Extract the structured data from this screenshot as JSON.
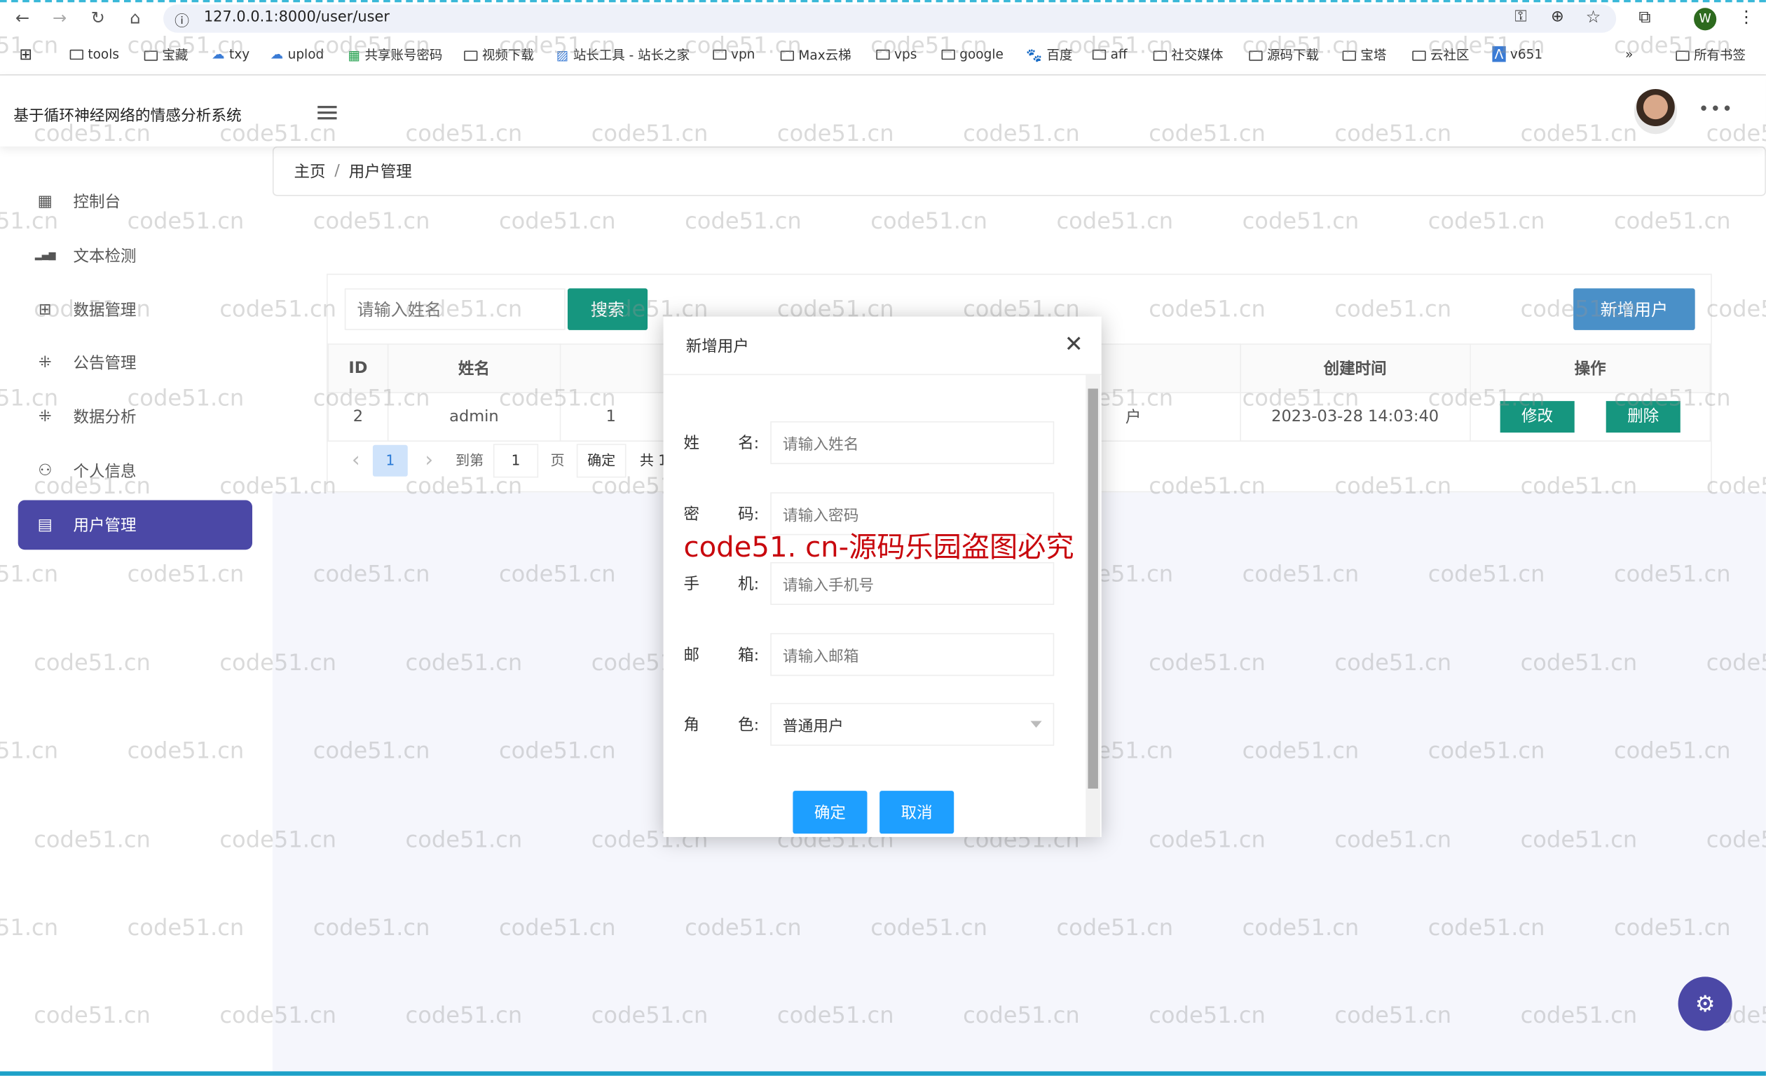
{
  "browser": {
    "url": "127.0.0.1:8000/user/user",
    "bookmarks": [
      {
        "label": "tools",
        "icon": "folder"
      },
      {
        "label": "宝藏",
        "icon": "folder"
      },
      {
        "label": "txy",
        "icon": "cloud"
      },
      {
        "label": "uplod",
        "icon": "cloud"
      },
      {
        "label": "共享账号密码",
        "icon": "sheet"
      },
      {
        "label": "视频下载",
        "icon": "folder"
      },
      {
        "label": "站长工具 - 站长之家",
        "icon": "site"
      },
      {
        "label": "vpn",
        "icon": "folder"
      },
      {
        "label": "Max云梯",
        "icon": "folder"
      },
      {
        "label": "vps",
        "icon": "folder"
      },
      {
        "label": "google",
        "icon": "folder"
      },
      {
        "label": "百度",
        "icon": "baidu"
      },
      {
        "label": "aff",
        "icon": "folder"
      },
      {
        "label": "社交媒体",
        "icon": "folder"
      },
      {
        "label": "源码下载",
        "icon": "folder"
      },
      {
        "label": "宝塔",
        "icon": "folder"
      },
      {
        "label": "云社区",
        "icon": "folder"
      },
      {
        "label": "v651",
        "icon": "app"
      }
    ],
    "all_bookmarks": "所有书签",
    "profile_initial": "W",
    "more_bookmarks": "»"
  },
  "app": {
    "title": "基于循环神经网络的情感分析系统"
  },
  "sidebar": {
    "items": [
      {
        "label": "控制台",
        "icon": "grid-icon"
      },
      {
        "label": "文本检测",
        "icon": "bar-chart-icon"
      },
      {
        "label": "数据管理",
        "icon": "table-icon"
      },
      {
        "label": "公告管理",
        "icon": "shrink-icon"
      },
      {
        "label": "数据分析",
        "icon": "shrink-icon"
      },
      {
        "label": "个人信息",
        "icon": "user-icon"
      },
      {
        "label": "用户管理",
        "icon": "document-icon",
        "active": true
      }
    ]
  },
  "breadcrumb": {
    "home": "主页",
    "sep": "/",
    "current": "用户管理"
  },
  "toolbar": {
    "search_placeholder": "请输入姓名",
    "search": "搜索",
    "add": "新增用户"
  },
  "table": {
    "headers": [
      "ID",
      "姓名",
      "",
      "",
      "",
      "创建时间",
      "操作"
    ],
    "rows": [
      {
        "id": "2",
        "name": "admin",
        "c3": "1",
        "c4": "",
        "c5": "户",
        "created": "2023-03-28 14:03:40",
        "edit": "修改",
        "delete": "删除"
      }
    ]
  },
  "pager": {
    "prev": "‹",
    "current": "1",
    "next": "›",
    "goto": "到第",
    "page_value": "1",
    "page_unit": "页",
    "confirm": "确定",
    "total": "共 1"
  },
  "modal": {
    "title": "新增用户",
    "close": "✕",
    "fields": [
      {
        "l1": "姓",
        "l2": "名:",
        "placeholder": "请输入姓名"
      },
      {
        "l1": "密",
        "l2": "码:",
        "placeholder": "请输入密码"
      },
      {
        "l1": "手",
        "l2": "机:",
        "placeholder": "请输入手机号"
      },
      {
        "l1": "邮",
        "l2": "箱:",
        "placeholder": "请输入邮箱"
      }
    ],
    "role": {
      "l1": "角",
      "l2": "色:",
      "value": "普通用户"
    },
    "ok": "确定",
    "cancel": "取消"
  },
  "watermark": "code51.cn",
  "watermark_red": "code51. cn-源码乐园盗图必究",
  "colors": {
    "primary": "#4b48a6",
    "teal": "#16967f",
    "blue": "#1e9fff",
    "add": "#4a90c8",
    "red_watermark": "#c8070d"
  }
}
